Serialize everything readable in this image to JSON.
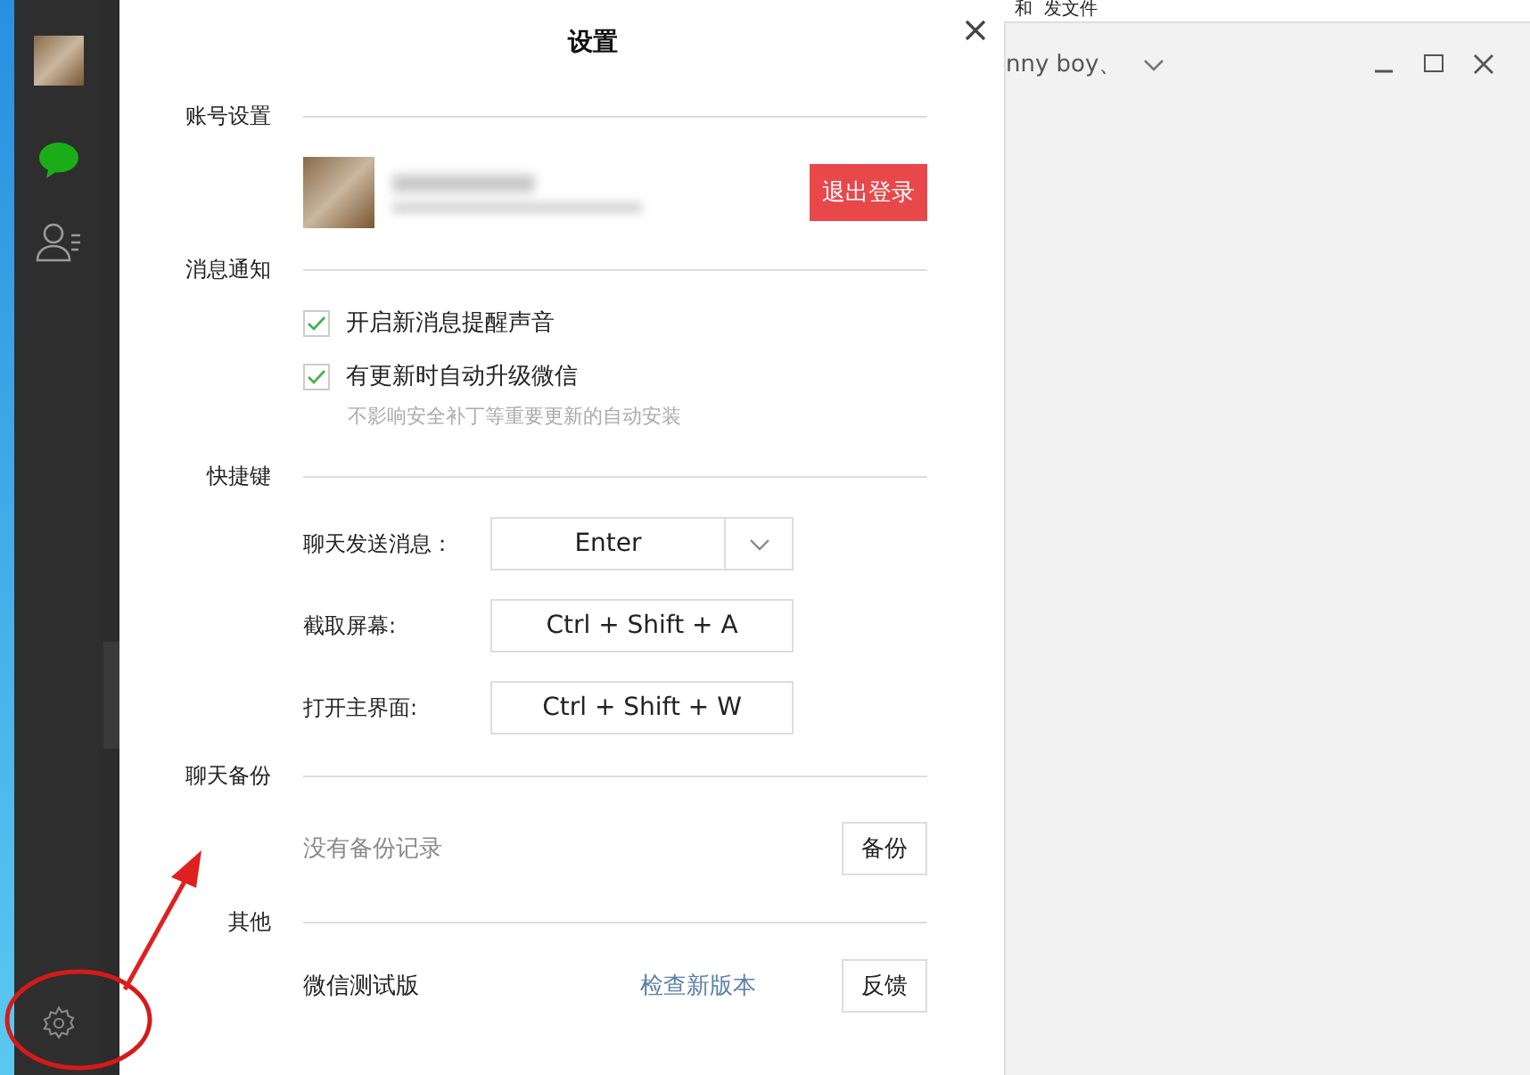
{
  "sidebar": {
    "items": [
      {
        "kind": "avatar"
      },
      {
        "kind": "chat"
      },
      {
        "kind": "contacts"
      },
      {
        "kind": "settings"
      }
    ]
  },
  "settings": {
    "title": "设置",
    "account": {
      "label": "账号设置",
      "logout_button": "退出登录"
    },
    "notifications": {
      "label": "消息通知",
      "options": [
        {
          "label": "开启新消息提醒声音",
          "checked": true
        },
        {
          "label": "有更新时自动升级微信",
          "checked": true,
          "hint": "不影响安全补丁等重要更新的自动安装"
        }
      ]
    },
    "shortcuts": {
      "label": "快捷键",
      "rows": [
        {
          "label": "聊天发送消息：",
          "value": "Enter",
          "kind": "dropdown"
        },
        {
          "label": "截取屏幕:",
          "value": "Ctrl + Shift + A",
          "kind": "key"
        },
        {
          "label": "打开主界面:",
          "value": "Ctrl + Shift + W",
          "kind": "key"
        }
      ]
    },
    "backup": {
      "label": "聊天备份",
      "status": "没有备份记录",
      "button": "备份"
    },
    "other": {
      "label": "其他",
      "version": "微信测试版",
      "link": "检查新版本",
      "button": "反馈"
    }
  },
  "background_window": {
    "top_text": "和  发文件",
    "contact": "nny boy、"
  }
}
